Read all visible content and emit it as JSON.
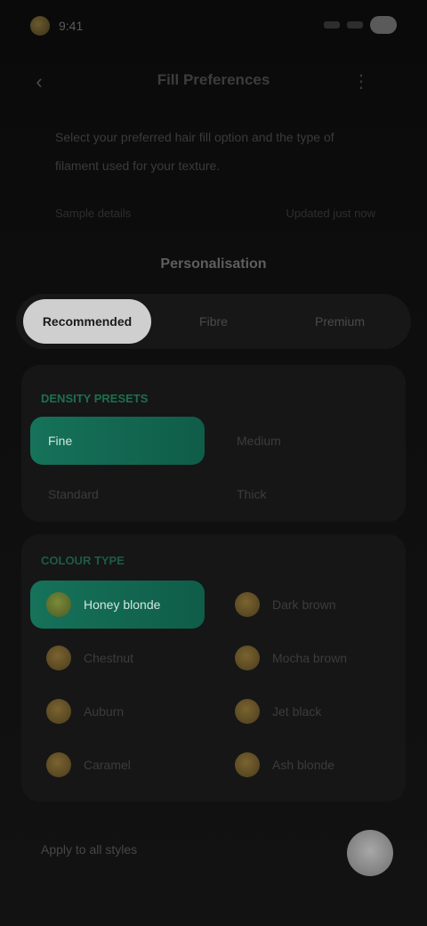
{
  "status_bar": {
    "time": "9:41"
  },
  "header": {
    "title": "Fill Preferences"
  },
  "description": {
    "text": "Select your preferred hair fill option and the type of filament used for your texture."
  },
  "info": {
    "left": "Sample details",
    "right": "Updated just now"
  },
  "section_heading": "Personalisation",
  "segments": [
    "Recommended",
    "Fibre",
    "Premium"
  ],
  "active_segment": 0,
  "card_1": {
    "heading": "DENSITY PRESETS",
    "options": [
      "Fine",
      "Medium",
      "Standard",
      "Thick"
    ],
    "selected": 0
  },
  "card_2": {
    "heading": "COLOUR TYPE",
    "options": [
      "Honey blonde",
      "Dark brown",
      "Chestnut",
      "Mocha brown",
      "Auburn",
      "Jet black",
      "Caramel",
      "Ash blonde"
    ],
    "selected": 0
  },
  "bottom": {
    "label": "Apply to all styles",
    "toggle_on": true
  },
  "colors": {
    "accent": "#16725a",
    "coin": "#7a6330"
  }
}
